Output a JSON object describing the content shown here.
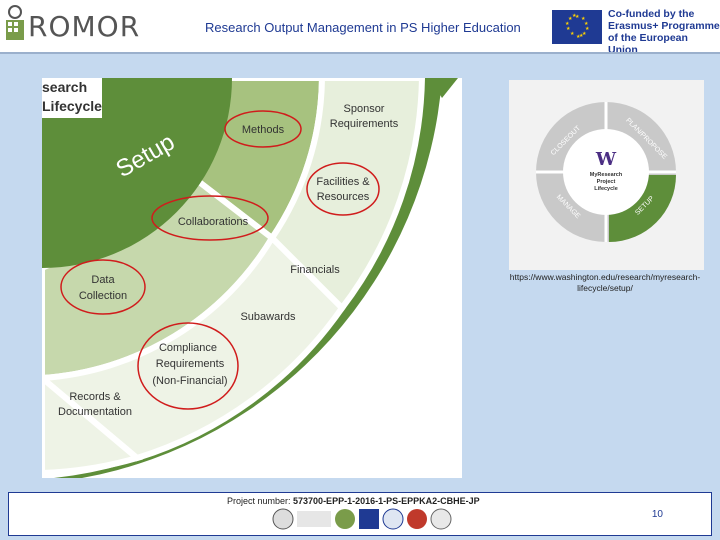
{
  "header": {
    "logo_text": "ROMOR",
    "title": "Research Output Management in PS Higher Education",
    "eu_line1": "Co-funded by the",
    "eu_line2": "Erasmus+ Programme",
    "eu_line3": "of the European Union"
  },
  "diagram": {
    "corner_title_1": "search",
    "corner_title_2": "Lifecycle",
    "setup_label": "Setup",
    "segments": {
      "methods": "Methods",
      "sponsor_1": "Sponsor",
      "sponsor_2": "Requirements",
      "facilities_1": "Facilities &",
      "facilities_2": "Resources",
      "collaborations": "Collaborations",
      "financials": "Financials",
      "data_1": "Data",
      "data_2": "Collection",
      "subawards": "Subawards",
      "compliance_1": "Compliance",
      "compliance_2": "Requirements",
      "compliance_3": "(Non-Financial)",
      "records_1": "Records &",
      "records_2": "Documentation"
    },
    "highlight_color": "#d01c1c",
    "accent_green": "#5e8e3a"
  },
  "wheel": {
    "w": "W",
    "center_1": "MyResearch",
    "center_2": "Project",
    "center_3": "Lifecycle",
    "closeout": "CLOSEOUT",
    "plan": "PLAN/PROPOSE",
    "manage": "MANAGE",
    "setup": "SETUP"
  },
  "source_url": "https://www.washington.edu/research/myresearch-lifecycle/setup/",
  "footer": {
    "project_prefix": "Project number: ",
    "project_number": "573700-EPP-1-2016-1-PS-EPPKA2-CBHE-JP",
    "page": "10"
  }
}
